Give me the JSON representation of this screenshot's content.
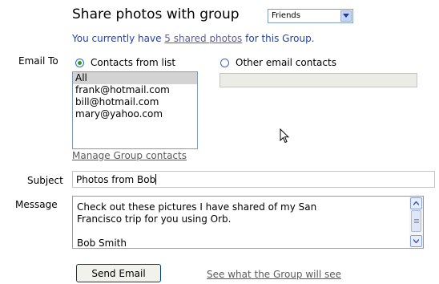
{
  "header": {
    "title": "Share photos with group",
    "group_select": {
      "selected": "Friends"
    }
  },
  "info": {
    "prefix": "You currently have ",
    "link": "5 shared photos",
    "suffix": " for this Group."
  },
  "email_to": {
    "label": "Email To",
    "option_contacts": "Contacts from list",
    "option_other": "Other email contacts",
    "selected_option": "Contacts from list",
    "contacts": [
      "All",
      "frank@hotmail.com",
      "bill@hotmail.com",
      "mary@yahoo.com"
    ],
    "selected_contact": "All",
    "other_value": "",
    "manage_link": "Manage Group contacts"
  },
  "subject": {
    "label": "Subject",
    "value": "Photos from Bob"
  },
  "message": {
    "label": "Message",
    "lines": [
      "Check out these pictures I have shared of my San",
      "Francisco trip for you using Orb.",
      "",
      "Bob Smith"
    ]
  },
  "actions": {
    "send_label": "Send Email",
    "preview_link": "See what the Group will see"
  },
  "icons": {
    "dropdown": "chevron-down-icon",
    "scroll_up": "scroll-up-icon",
    "scroll_down": "scroll-down-icon",
    "cursor": "mouse-pointer-icon"
  },
  "colors": {
    "info_text": "#1b42b8",
    "link_text": "#5a5a5a",
    "radio_dot": "#2d9b2d",
    "selected_item_bg": "#d3d3d3",
    "disabled_input_bg": "#ecece6"
  }
}
